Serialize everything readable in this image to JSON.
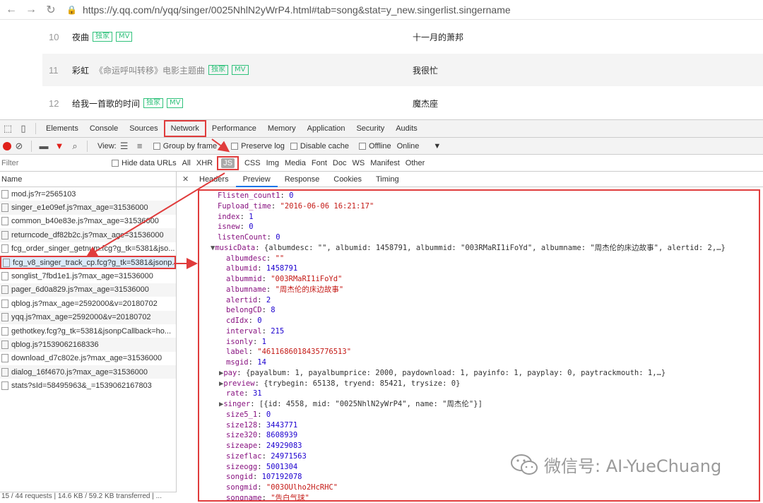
{
  "browser": {
    "url": "https://y.qq.com/n/yqq/singer/0025NhlN2yWrP4.html#tab=song&stat=y_new.singerlist.singername"
  },
  "songs": [
    {
      "num": "10",
      "title": "夜曲",
      "subtitle": "",
      "badges": [
        "独家",
        "MV"
      ],
      "artist": "十一月的萧邦"
    },
    {
      "num": "11",
      "title": "彩虹",
      "subtitle": "《命运呼叫转移》电影主题曲",
      "badges": [
        "独家",
        "MV"
      ],
      "artist": "我很忙"
    },
    {
      "num": "12",
      "title": "给我一首歌的时间",
      "subtitle": "",
      "badges": [
        "独家",
        "MV"
      ],
      "artist": "魔杰座"
    }
  ],
  "devtools": {
    "tabs": [
      "Elements",
      "Console",
      "Sources",
      "Network",
      "Performance",
      "Memory",
      "Application",
      "Security",
      "Audits"
    ],
    "active_tab": "Network",
    "toolbar": {
      "view": "View:",
      "group_by_frame": "Group by frame",
      "preserve_log": "Preserve log",
      "disable_cache": "Disable cache",
      "offline": "Offline",
      "online": "Online"
    },
    "filter": {
      "placeholder": "Filter",
      "hide_data_urls": "Hide data URLs",
      "types": [
        "All",
        "XHR",
        "JS",
        "CSS",
        "Img",
        "Media",
        "Font",
        "Doc",
        "WS",
        "Manifest",
        "Other"
      ],
      "active_type": "JS"
    },
    "name_header": "Name",
    "requests": [
      "mod.js?r=2565103",
      "singer_e1e09ef.js?max_age=31536000",
      "common_b40e83e.js?max_age=31536000",
      "returncode_df82b2c.js?max_age=31536000",
      "fcg_order_singer_getnum.fcg?g_tk=5381&jso...",
      "fcg_v8_singer_track_cp.fcg?g_tk=5381&jsonp...",
      "songlist_7fbd1e1.js?max_age=31536000",
      "pager_6d0a829.js?max_age=31536000",
      "qblog.js?max_age=2592000&v=20180702",
      "yqq.js?max_age=2592000&v=20180702",
      "gethotkey.fcg?g_tk=5381&jsonpCallback=ho...",
      "qblog.js?1539062168336",
      "download_d7c802e.js?max_age=31536000",
      "dialog_16f4670.js?max_age=31536000",
      "stats?sId=58495963&_=1539062167803"
    ],
    "selected_request_index": 5,
    "status": "15 / 44 requests | 14.6 KB / 59.2 KB transferred | ...",
    "detail_tabs": [
      "Headers",
      "Preview",
      "Response",
      "Cookies",
      "Timing"
    ],
    "active_detail_tab": "Preview",
    "preview_lines": [
      {
        "indent": 0,
        "tri": "",
        "key": "Flisten_count1",
        "val": "0",
        "type": "n"
      },
      {
        "indent": 0,
        "tri": "",
        "key": "Fupload_time",
        "val": "\"2016-06-06 16:21:17\"",
        "type": "s"
      },
      {
        "indent": 0,
        "tri": "",
        "key": "index",
        "val": "1",
        "type": "n"
      },
      {
        "indent": 0,
        "tri": "",
        "key": "isnew",
        "val": "0",
        "type": "n"
      },
      {
        "indent": 0,
        "tri": "",
        "key": "listenCount",
        "val": "0",
        "type": "n"
      },
      {
        "indent": 0,
        "tri": "▼",
        "key": "musicData",
        "val": "{albumdesc: \"\", albumid: 1458791, albummid: \"003RMaRI1iFoYd\", albumname: \"周杰伦的床边故事\", alertid: 2,…}",
        "type": "o"
      },
      {
        "indent": 1,
        "tri": "",
        "key": "albumdesc",
        "val": "\"\"",
        "type": "s"
      },
      {
        "indent": 1,
        "tri": "",
        "key": "albumid",
        "val": "1458791",
        "type": "n"
      },
      {
        "indent": 1,
        "tri": "",
        "key": "albummid",
        "val": "\"003RMaRI1iFoYd\"",
        "type": "s"
      },
      {
        "indent": 1,
        "tri": "",
        "key": "albumname",
        "val": "\"周杰伦的床边故事\"",
        "type": "s"
      },
      {
        "indent": 1,
        "tri": "",
        "key": "alertid",
        "val": "2",
        "type": "n"
      },
      {
        "indent": 1,
        "tri": "",
        "key": "belongCD",
        "val": "8",
        "type": "n"
      },
      {
        "indent": 1,
        "tri": "",
        "key": "cdIdx",
        "val": "0",
        "type": "n"
      },
      {
        "indent": 1,
        "tri": "",
        "key": "interval",
        "val": "215",
        "type": "n"
      },
      {
        "indent": 1,
        "tri": "",
        "key": "isonly",
        "val": "1",
        "type": "n"
      },
      {
        "indent": 1,
        "tri": "",
        "key": "label",
        "val": "\"4611686018435776513\"",
        "type": "s"
      },
      {
        "indent": 1,
        "tri": "",
        "key": "msgid",
        "val": "14",
        "type": "n"
      },
      {
        "indent": 1,
        "tri": "▶",
        "key": "pay",
        "val": "{payalbum: 1, payalbumprice: 2000, paydownload: 1, payinfo: 1, payplay: 0, paytrackmouth: 1,…}",
        "type": "o"
      },
      {
        "indent": 1,
        "tri": "▶",
        "key": "preview",
        "val": "{trybegin: 65138, tryend: 85421, trysize: 0}",
        "type": "o"
      },
      {
        "indent": 1,
        "tri": "",
        "key": "rate",
        "val": "31",
        "type": "n"
      },
      {
        "indent": 1,
        "tri": "▶",
        "key": "singer",
        "val": "[{id: 4558, mid: \"0025NhlN2yWrP4\", name: \"周杰伦\"}]",
        "type": "o"
      },
      {
        "indent": 1,
        "tri": "",
        "key": "size5_1",
        "val": "0",
        "type": "n"
      },
      {
        "indent": 1,
        "tri": "",
        "key": "size128",
        "val": "3443771",
        "type": "n"
      },
      {
        "indent": 1,
        "tri": "",
        "key": "size320",
        "val": "8608939",
        "type": "n"
      },
      {
        "indent": 1,
        "tri": "",
        "key": "sizeape",
        "val": "24929083",
        "type": "n"
      },
      {
        "indent": 1,
        "tri": "",
        "key": "sizeflac",
        "val": "24971563",
        "type": "n"
      },
      {
        "indent": 1,
        "tri": "",
        "key": "sizeogg",
        "val": "5001304",
        "type": "n"
      },
      {
        "indent": 1,
        "tri": "",
        "key": "songid",
        "val": "107192078",
        "type": "n"
      },
      {
        "indent": 1,
        "tri": "",
        "key": "songmid",
        "val": "\"003OUlho2HcRHC\"",
        "type": "s"
      },
      {
        "indent": 1,
        "tri": "",
        "key": "songname",
        "val": "\"告白气球\"",
        "type": "s"
      }
    ]
  },
  "watermark": {
    "text": "微信号: AI-YueChuang",
    "icon": "wechat-icon"
  },
  "colors": {
    "highlight": "#e03c3c",
    "badge": "#31c27c"
  }
}
